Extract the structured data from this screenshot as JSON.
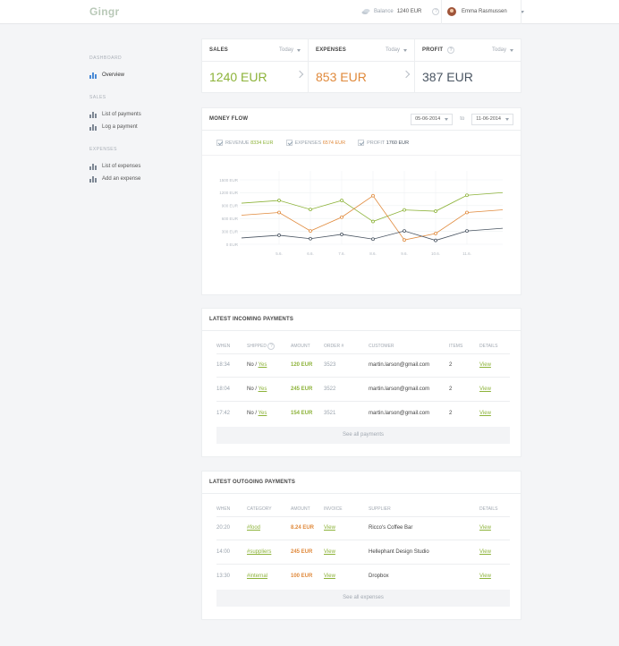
{
  "colors": {
    "green": "#8db33a",
    "orange": "#e08a3c",
    "dark": "#4a5562",
    "brand": "#b9c9b8"
  },
  "brand": "Gingr",
  "header": {
    "balance_label": "Balance",
    "balance_value": "1240 EUR",
    "help": "?",
    "user_name": "Emma Rasmussen"
  },
  "sidebar": {
    "dashboard_head": "DASHBOARD",
    "overview": "Overview",
    "sales_head": "SALES",
    "list_payments": "List of payments",
    "log_payment": "Log a payment",
    "expenses_head": "EXPENSES",
    "list_expenses": "List of expenses",
    "add_expense": "Add an expense"
  },
  "stats": [
    {
      "label": "SALES",
      "period": "Today",
      "value": "1240 EUR",
      "color": "#8db33a"
    },
    {
      "label": "EXPENSES",
      "period": "Today",
      "value": "853 EUR",
      "color": "#e08a3c"
    },
    {
      "label": "PROFIT",
      "period": "Today",
      "value": "387 EUR",
      "color": "#4a5562"
    }
  ],
  "money_flow": {
    "title": "MONEY FLOW",
    "date_from": "05-06-2014",
    "to_label": "to",
    "date_to": "11-06-2014",
    "legend": [
      {
        "label": "REVENUE",
        "value": "8334 EUR",
        "color": "#8db33a"
      },
      {
        "label": "EXPENSES",
        "value": "6574 EUR",
        "color": "#e08a3c"
      },
      {
        "label": "PROFIT",
        "value": "1760 EUR",
        "color": "#4a5562"
      }
    ]
  },
  "chart_data": {
    "type": "line",
    "x": [
      "5.6.",
      "6.6.",
      "7.6.",
      "8.6.",
      "9.6.",
      "10.6.",
      "11.6."
    ],
    "y_ticks": [
      "1500 EUR",
      "1200 EUR",
      "900 EUR",
      "600 EUR",
      "300 EUR",
      "0 EUR"
    ],
    "ylim": [
      0,
      1500
    ],
    "series": [
      {
        "name": "REVENUE",
        "color": "#8db33a",
        "values": [
          1020,
          810,
          1020,
          530,
          800,
          770,
          1140
        ]
      },
      {
        "name": "EXPENSES",
        "color": "#e08a3c",
        "values": [
          740,
          310,
          630,
          1130,
          100,
          250,
          740
        ]
      },
      {
        "name": "PROFIT",
        "color": "#4a5562",
        "values": [
          210,
          130,
          230,
          120,
          310,
          90,
          310
        ]
      }
    ]
  },
  "incoming": {
    "title": "LATEST INCOMING PAYMENTS",
    "columns": [
      "WHEN",
      "SHIPPED",
      "AMOUNT",
      "ORDER #",
      "CUSTOMER",
      "ITEMS",
      "DETAILS"
    ],
    "rows": [
      {
        "when": "18:34",
        "no": "No",
        "sep": "/",
        "yes": "Yes",
        "amount": "120 EUR",
        "order": "3523",
        "customer": "martin.larson@gmail.com",
        "items": "2",
        "details": "View"
      },
      {
        "when": "18:04",
        "no": "No",
        "sep": "/",
        "yes": "Yes",
        "amount": "245 EUR",
        "order": "3522",
        "customer": "martin.larson@gmail.com",
        "items": "2",
        "details": "View"
      },
      {
        "when": "17:42",
        "no": "No",
        "sep": "/",
        "yes": "Yes",
        "amount": "154 EUR",
        "order": "3521",
        "customer": "martin.larson@gmail.com",
        "items": "2",
        "details": "View"
      }
    ],
    "see_all": "See all payments"
  },
  "outgoing": {
    "title": "LATEST OUTGOING PAYMENTS",
    "columns": [
      "WHEN",
      "CATEGORY",
      "AMOUNT",
      "INVOICE",
      "SUPPLIER",
      "DETAILS"
    ],
    "rows": [
      {
        "when": "20:20",
        "category": "#food",
        "amount": "8.24 EUR",
        "invoice": "View",
        "supplier": "Ricco's Coffee Bar",
        "details": "View"
      },
      {
        "when": "14:00",
        "category": "#suppliers",
        "amount": "245 EUR",
        "invoice": "View",
        "supplier": "Hellephant Design Studio",
        "details": "View"
      },
      {
        "when": "13:30",
        "category": "#internal",
        "amount": "100 EUR",
        "invoice": "View",
        "supplier": "Dropbox",
        "details": "View"
      }
    ],
    "see_all": "See all expenses"
  }
}
